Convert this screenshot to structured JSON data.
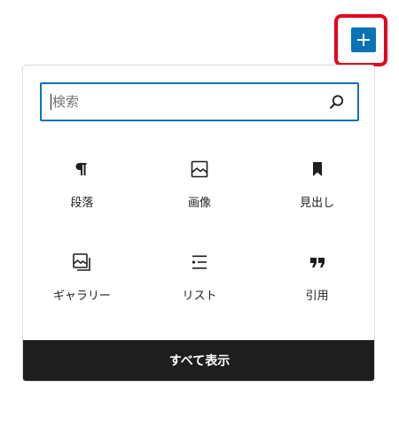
{
  "colors": {
    "accent": "#0a73b5",
    "highlight": "#e6001e",
    "dark": "#1e1e1e"
  },
  "add_button": {
    "icon": "plus-icon"
  },
  "search": {
    "placeholder": "検索",
    "value": "",
    "icon": "search-icon"
  },
  "blocks": [
    {
      "label": "段落",
      "icon": "paragraph-icon"
    },
    {
      "label": "画像",
      "icon": "image-icon"
    },
    {
      "label": "見出し",
      "icon": "heading-bookmark-icon"
    },
    {
      "label": "ギャラリー",
      "icon": "gallery-icon"
    },
    {
      "label": "リスト",
      "icon": "list-icon"
    },
    {
      "label": "引用",
      "icon": "quote-icon"
    }
  ],
  "footer": {
    "show_all_label": "すべて表示"
  }
}
